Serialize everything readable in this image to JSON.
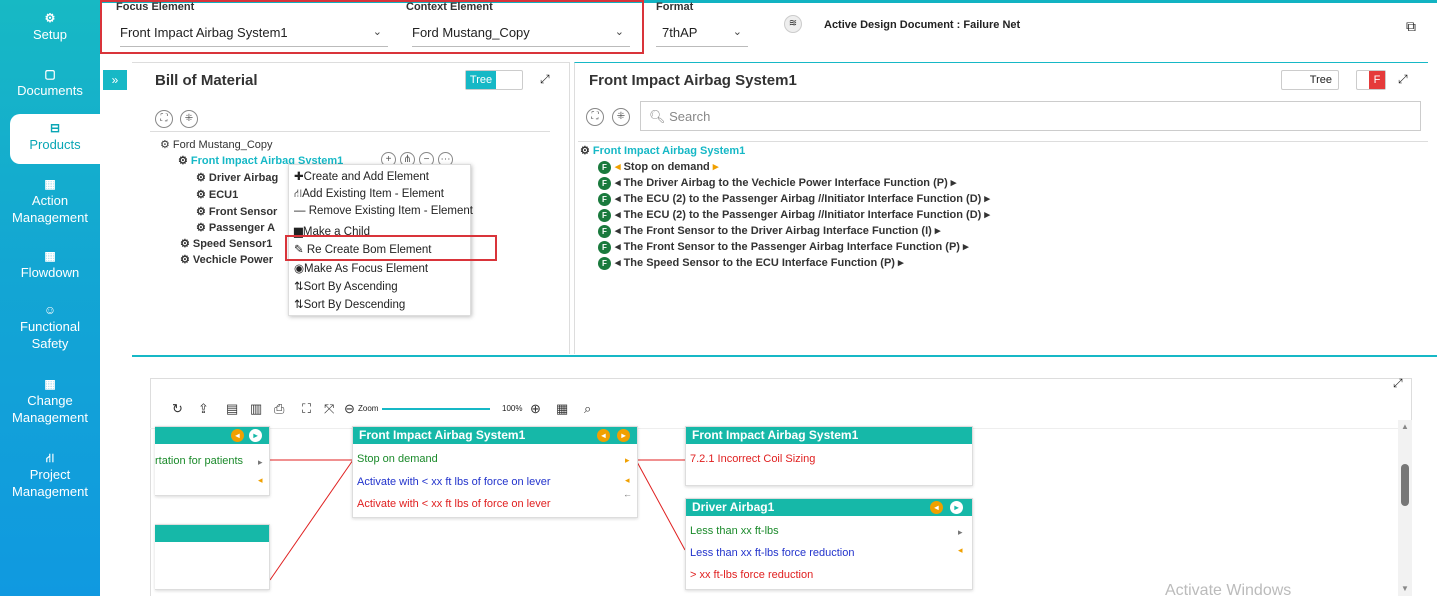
{
  "sidebar": {
    "items": [
      {
        "label": "Setup",
        "icon": "gears-icon"
      },
      {
        "label": "Documents",
        "icon": "document-icon"
      },
      {
        "label": "Products",
        "icon": "product-icon"
      },
      {
        "label": "Action Management",
        "icon": "building-icon"
      },
      {
        "label": "Flowdown",
        "icon": "building-icon"
      },
      {
        "label": "Functional Safety",
        "icon": "safety-icon"
      },
      {
        "label": "Change Management",
        "icon": "building-icon"
      },
      {
        "label": "Project Management",
        "icon": "project-icon"
      }
    ],
    "active": "Products"
  },
  "topbar": {
    "focus_label": "Focus Element",
    "focus_value": "Front Impact Airbag System1",
    "context_label": "Context Element",
    "context_value": "Ford Mustang_Copy",
    "format_label": "Format",
    "format_value": "7thAP",
    "active_doc": "Active Design Document : Failure Net"
  },
  "bom": {
    "title": "Bill of Material",
    "toggle_label": "Tree",
    "tree": {
      "root": "Ford Mustang_Copy",
      "selected": "Front Impact Airbag System1",
      "children": [
        "Driver Airbag",
        "ECU1",
        "Front Sensor",
        "Passenger A"
      ],
      "siblings": [
        "Speed Sensor1",
        "Vechicle Power"
      ]
    }
  },
  "context_menu": {
    "items": [
      "Create and Add Element",
      "Add Existing Item - Element",
      "Remove Existing Item - Element",
      "Make a Child",
      "Re Create Bom Element",
      "Make As Focus Element",
      "Sort By Ascending",
      "Sort By Descending"
    ],
    "highlighted": "Re Create Bom Element"
  },
  "functions_panel": {
    "title": "Front Impact Airbag System1",
    "toggle_label": "Tree",
    "toggle_right": "F",
    "search_placeholder": "Search",
    "root": "Front Impact Airbag System1",
    "functions": [
      "Stop on demand",
      "The Driver Airbag to the Vechicle Power Interface Function (P)",
      "The ECU (2) to the Passenger Airbag //Initiator Interface Function (D)",
      "The ECU (2) to the Passenger Airbag //Initiator Interface Function (D)",
      "The Front Sensor to the Driver Airbag Interface Function (I)",
      "The Front Sensor to the Passenger Airbag Interface Function (P)",
      "The Speed Sensor to the ECU Interface Function (P)"
    ]
  },
  "net_toolbar": {
    "zoom_label": "Zoom",
    "zoom_value": "100%"
  },
  "net": {
    "left_node": {
      "row1": "rtation for patients"
    },
    "center_node": {
      "title": "Front Impact Airbag System1",
      "rows": [
        "Stop on demand",
        "Activate with < xx ft lbs of force on lever",
        "Activate with < xx ft lbs of force on lever"
      ]
    },
    "right_top_node": {
      "title": "Front Impact Airbag System1",
      "rows": [
        "7.2.1 Incorrect Coil Sizing"
      ]
    },
    "right_bottom_node": {
      "title": "Driver Airbag1",
      "rows": [
        "Less than xx ft-lbs",
        "Less than xx ft-lbs force reduction",
        "> xx ft-lbs force reduction"
      ]
    },
    "watermark": "Activate Windows"
  },
  "colors": {
    "accent": "#16b8c6",
    "highlight": "#d9343a",
    "failure_red": "#e02020",
    "effect_blue": "#2233cc",
    "function_green": "#1a8a2a"
  }
}
